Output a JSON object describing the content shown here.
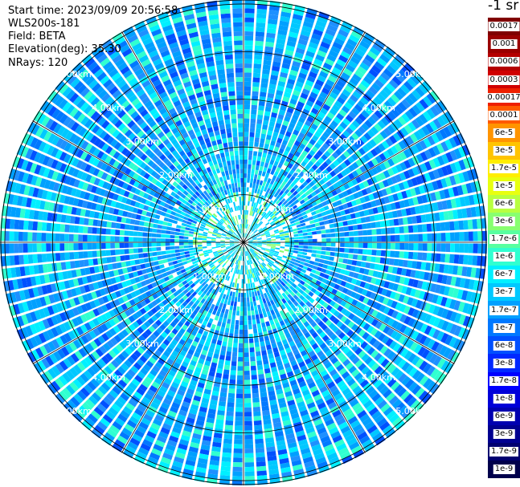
{
  "info": {
    "start_time": "Start time: 2023/09/09 20:56:58",
    "instrument": "WLS200s-181",
    "field": "Field: BETA",
    "elevation": "Elevation(deg): 35.30",
    "nrays": "NRays: 120"
  },
  "colorbar": {
    "unit_label": "-1 sr",
    "levels": [
      {
        "label": "0.0017",
        "color": "#800000"
      },
      {
        "label": "0.001",
        "color": "#9a0000"
      },
      {
        "label": "0.0006",
        "color": "#b40000"
      },
      {
        "label": "0.0003",
        "color": "#d00000"
      },
      {
        "label": "0.00017",
        "color": "#ee2000"
      },
      {
        "label": "0.0001",
        "color": "#ff5a00"
      },
      {
        "label": "6e-5",
        "color": "#ff9400"
      },
      {
        "label": "3e-5",
        "color": "#ffc400"
      },
      {
        "label": "1.7e-5",
        "color": "#ffee00"
      },
      {
        "label": "1e-5",
        "color": "#e8ff10"
      },
      {
        "label": "6e-6",
        "color": "#b8ff40"
      },
      {
        "label": "3e-6",
        "color": "#88ff70"
      },
      {
        "label": "1.7e-6",
        "color": "#58ffa0"
      },
      {
        "label": "1e-6",
        "color": "#30ffd0"
      },
      {
        "label": "6e-7",
        "color": "#00f0ff"
      },
      {
        "label": "3e-7",
        "color": "#00c8ff"
      },
      {
        "label": "1.7e-7",
        "color": "#00a0ff"
      },
      {
        "label": "1e-7",
        "color": "#0078ff"
      },
      {
        "label": "6e-8",
        "color": "#0050ff"
      },
      {
        "label": "3e-8",
        "color": "#0028ff"
      },
      {
        "label": "1.7e-8",
        "color": "#0000ff"
      },
      {
        "label": "1e-8",
        "color": "#0000d8"
      },
      {
        "label": "6e-9",
        "color": "#0000b0"
      },
      {
        "label": "3e-9",
        "color": "#000090"
      },
      {
        "label": "1.7e-9",
        "color": "#000070"
      },
      {
        "label": "1e-9",
        "color": "#00004c"
      }
    ]
  },
  "chart_data": {
    "type": "heatmap",
    "title": "",
    "projection": "polar plan position indicator",
    "field": "BETA",
    "elevation_deg": 35.3,
    "n_rays": 120,
    "range_rings_km": [
      1,
      2,
      3,
      4,
      5
    ],
    "max_range_km": 5.1,
    "spoke_angles_deg": [
      0,
      30,
      60,
      90,
      120,
      150,
      180,
      210,
      240,
      270,
      300,
      330
    ],
    "ring_labels": [
      "1.00km",
      "2.00km",
      "3.00km",
      "4.00km",
      "5.00km"
    ],
    "ring_label_bearings_deg": [
      315,
      45,
      135,
      225
    ],
    "typical_value_range": [
      "6e-8",
      "1e-6"
    ],
    "near_range_max_value": "1e-5",
    "colors": {
      "background_data": "#1e90ff",
      "grid": "#000000",
      "ray_gap": "#ffffff"
    }
  }
}
